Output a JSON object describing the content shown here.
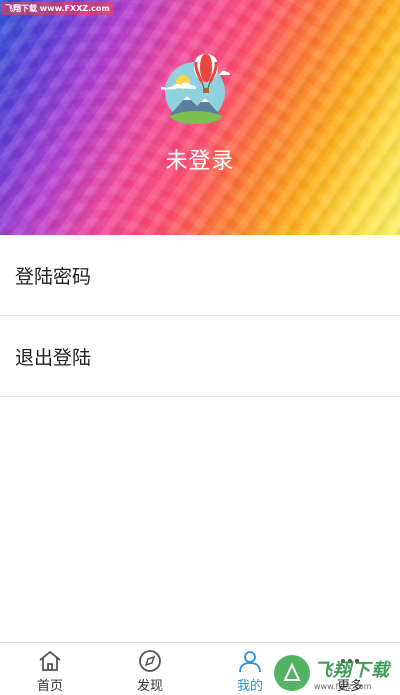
{
  "watermark_top": "飞翔下载 www.FXXZ.com",
  "profile": {
    "status": "未登录"
  },
  "menu": [
    {
      "label": "登陆密码"
    },
    {
      "label": "退出登陆"
    }
  ],
  "tabs": [
    {
      "label": "首页",
      "icon": "home-icon",
      "active": false
    },
    {
      "label": "发现",
      "icon": "compass-icon",
      "active": false
    },
    {
      "label": "我的",
      "icon": "user-icon",
      "active": true
    },
    {
      "label": "更多",
      "icon": "more-icon",
      "active": false
    }
  ],
  "watermark_br": {
    "main": "飞翔下载",
    "sub": "www.fxxz.com"
  },
  "colors": {
    "accent": "#2f8de4",
    "text": "#222222",
    "divider": "#e7e7e7"
  }
}
